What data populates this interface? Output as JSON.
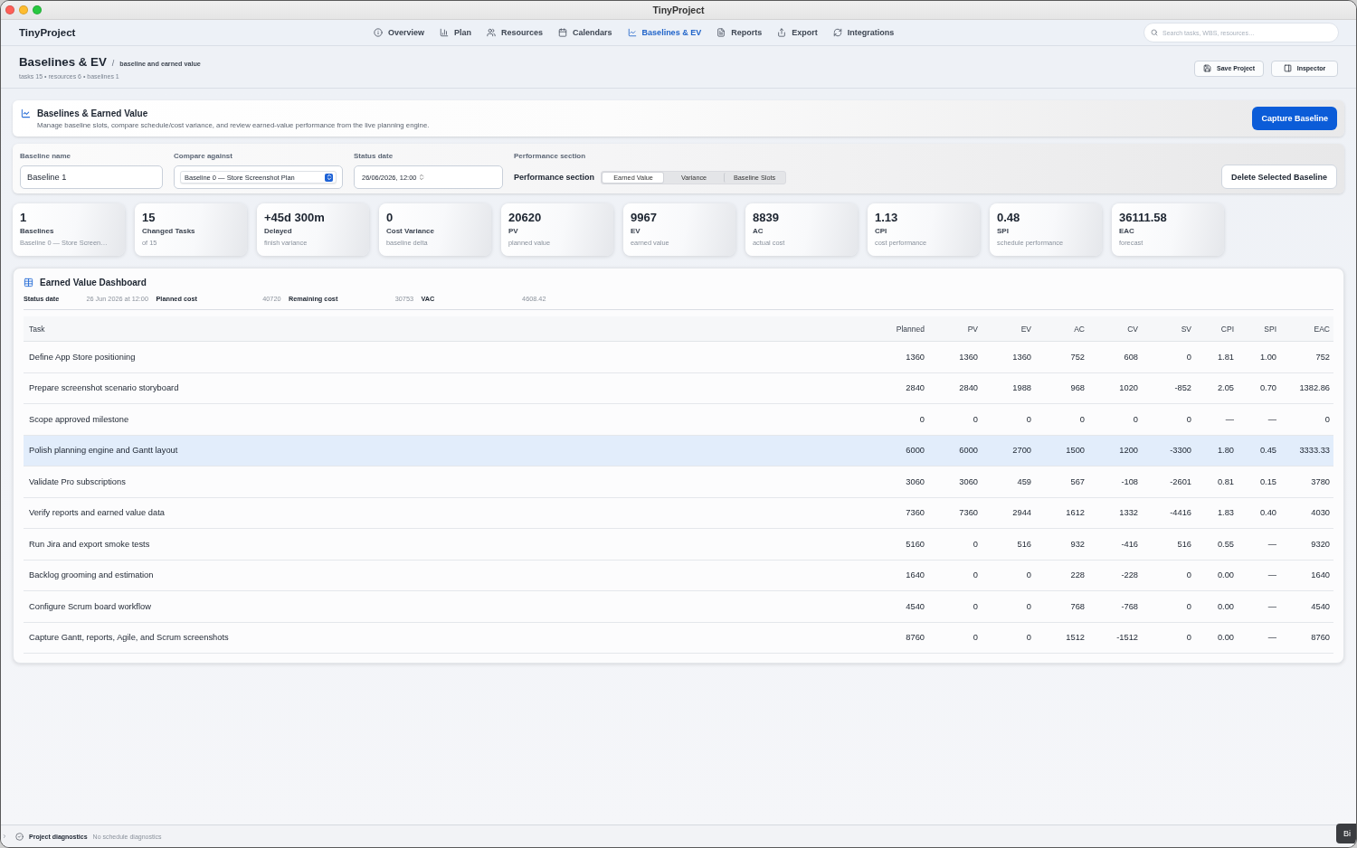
{
  "window": {
    "title": "TinyProject"
  },
  "app_bar": {
    "brand": "TinyProject",
    "nav": [
      {
        "label": "Overview",
        "selected": false
      },
      {
        "label": "Plan",
        "selected": false
      },
      {
        "label": "Resources",
        "selected": false
      },
      {
        "label": "Calendars",
        "selected": false
      },
      {
        "label": "Baselines & EV",
        "selected": true
      },
      {
        "label": "Reports",
        "selected": false
      },
      {
        "label": "Export",
        "selected": false
      },
      {
        "label": "Integrations",
        "selected": false
      }
    ],
    "search": {
      "placeholder": "Search tasks, WBS, resources…"
    }
  },
  "page_header": {
    "title": "Baselines & EV",
    "separator": "/",
    "subtitle": "baseline and earned value",
    "meta": "tasks 15 • resources 6 • baselines 1",
    "actions": [
      {
        "label": "Save Project"
      },
      {
        "label": "Inspector"
      }
    ]
  },
  "intro_card": {
    "title": "Baselines & Earned Value",
    "description": "Manage baseline slots, compare schedule/cost variance, and review earned-value performance from the live planning engine.",
    "action": "Capture Baseline"
  },
  "form": {
    "baseline_name": {
      "label": "Baseline name",
      "value": "Baseline 1"
    },
    "compare_against": {
      "label": "Compare against",
      "value": "Baseline 0 — Store Screenshot Plan"
    },
    "status_date": {
      "label": "Status date",
      "value": "26/06/2026, 12:00"
    },
    "performance_section": {
      "label": "Performance section",
      "inline_label": "Performance section",
      "options": [
        {
          "label": "Earned Value",
          "selected": true
        },
        {
          "label": "Variance",
          "selected": false
        },
        {
          "label": "Baseline Slots",
          "selected": false
        }
      ]
    },
    "delete_button": "Delete Selected Baseline"
  },
  "stats": [
    {
      "value": "1",
      "label": "Baselines",
      "caption": "Baseline 0 — Store Screen…"
    },
    {
      "value": "15",
      "label": "Changed Tasks",
      "caption": "of 15"
    },
    {
      "value": "+45d 300m",
      "label": "Delayed",
      "caption": "finish variance"
    },
    {
      "value": "0",
      "label": "Cost Variance",
      "caption": "baseline delta"
    },
    {
      "value": "20620",
      "label": "PV",
      "caption": "planned value"
    },
    {
      "value": "9967",
      "label": "EV",
      "caption": "earned value"
    },
    {
      "value": "8839",
      "label": "AC",
      "caption": "actual cost"
    },
    {
      "value": "1.13",
      "label": "CPI",
      "caption": "cost performance"
    },
    {
      "value": "0.48",
      "label": "SPI",
      "caption": "schedule performance"
    },
    {
      "value": "36111.58",
      "label": "EAC",
      "caption": "forecast"
    }
  ],
  "dashboard": {
    "title": "Earned Value Dashboard",
    "summary": [
      {
        "label": "Status date",
        "value": "26 Jun 2026 at 12:00"
      },
      {
        "label": "Planned cost",
        "value": "40720"
      },
      {
        "label": "Remaining cost",
        "value": "30753"
      },
      {
        "label": "VAC",
        "value": "4608.42"
      }
    ],
    "table": {
      "columns": [
        "Task",
        "Planned",
        "PV",
        "EV",
        "AC",
        "CV",
        "SV",
        "CPI",
        "SPI",
        "EAC"
      ],
      "rows": [
        {
          "selected": false,
          "cells": [
            "Define App Store positioning",
            "1360",
            "1360",
            "1360",
            "752",
            "608",
            "0",
            "1.81",
            "1.00",
            "752"
          ]
        },
        {
          "selected": false,
          "cells": [
            "Prepare screenshot scenario storyboard",
            "2840",
            "2840",
            "1988",
            "968",
            "1020",
            "-852",
            "2.05",
            "0.70",
            "1382.86"
          ]
        },
        {
          "selected": false,
          "cells": [
            "Scope approved milestone",
            "0",
            "0",
            "0",
            "0",
            "0",
            "0",
            "—",
            "—",
            "0"
          ]
        },
        {
          "selected": true,
          "cells": [
            "Polish planning engine and Gantt layout",
            "6000",
            "6000",
            "2700",
            "1500",
            "1200",
            "-3300",
            "1.80",
            "0.45",
            "3333.33"
          ]
        },
        {
          "selected": false,
          "cells": [
            "Validate Pro subscriptions",
            "3060",
            "3060",
            "459",
            "567",
            "-108",
            "-2601",
            "0.81",
            "0.15",
            "3780"
          ]
        },
        {
          "selected": false,
          "cells": [
            "Verify reports and earned value data",
            "7360",
            "7360",
            "2944",
            "1612",
            "1332",
            "-4416",
            "1.83",
            "0.40",
            "4030"
          ]
        },
        {
          "selected": false,
          "cells": [
            "Run Jira and export smoke tests",
            "5160",
            "0",
            "516",
            "932",
            "-416",
            "516",
            "0.55",
            "—",
            "9320"
          ]
        },
        {
          "selected": false,
          "cells": [
            "Backlog grooming and estimation",
            "1640",
            "0",
            "0",
            "228",
            "-228",
            "0",
            "0.00",
            "—",
            "1640"
          ]
        },
        {
          "selected": false,
          "cells": [
            "Configure Scrum board workflow",
            "4540",
            "0",
            "0",
            "768",
            "-768",
            "0",
            "0.00",
            "—",
            "4540"
          ]
        },
        {
          "selected": false,
          "cells": [
            "Capture Gantt, reports, Agile, and Scrum screenshots",
            "8760",
            "0",
            "0",
            "1512",
            "-1512",
            "0",
            "0.00",
            "—",
            "8760"
          ]
        }
      ]
    }
  },
  "status_bar": {
    "title": "Project diagnostics",
    "message": "No schedule diagnostics"
  },
  "tooltip": {
    "text": "Bi"
  }
}
